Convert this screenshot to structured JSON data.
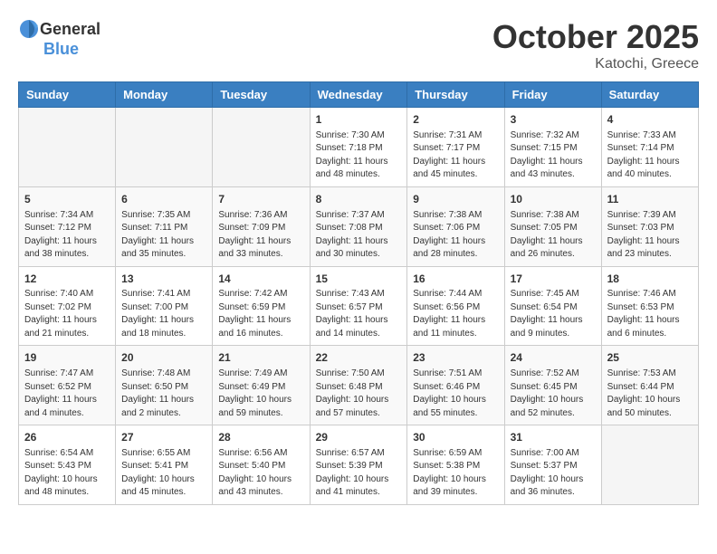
{
  "header": {
    "logo_general": "General",
    "logo_blue": "Blue",
    "title": "October 2025",
    "location": "Katochi, Greece"
  },
  "weekdays": [
    "Sunday",
    "Monday",
    "Tuesday",
    "Wednesday",
    "Thursday",
    "Friday",
    "Saturday"
  ],
  "weeks": [
    [
      {
        "day": "",
        "sunrise": "",
        "sunset": "",
        "daylight": ""
      },
      {
        "day": "",
        "sunrise": "",
        "sunset": "",
        "daylight": ""
      },
      {
        "day": "",
        "sunrise": "",
        "sunset": "",
        "daylight": ""
      },
      {
        "day": "1",
        "sunrise": "Sunrise: 7:30 AM",
        "sunset": "Sunset: 7:18 PM",
        "daylight": "Daylight: 11 hours and 48 minutes."
      },
      {
        "day": "2",
        "sunrise": "Sunrise: 7:31 AM",
        "sunset": "Sunset: 7:17 PM",
        "daylight": "Daylight: 11 hours and 45 minutes."
      },
      {
        "day": "3",
        "sunrise": "Sunrise: 7:32 AM",
        "sunset": "Sunset: 7:15 PM",
        "daylight": "Daylight: 11 hours and 43 minutes."
      },
      {
        "day": "4",
        "sunrise": "Sunrise: 7:33 AM",
        "sunset": "Sunset: 7:14 PM",
        "daylight": "Daylight: 11 hours and 40 minutes."
      }
    ],
    [
      {
        "day": "5",
        "sunrise": "Sunrise: 7:34 AM",
        "sunset": "Sunset: 7:12 PM",
        "daylight": "Daylight: 11 hours and 38 minutes."
      },
      {
        "day": "6",
        "sunrise": "Sunrise: 7:35 AM",
        "sunset": "Sunset: 7:11 PM",
        "daylight": "Daylight: 11 hours and 35 minutes."
      },
      {
        "day": "7",
        "sunrise": "Sunrise: 7:36 AM",
        "sunset": "Sunset: 7:09 PM",
        "daylight": "Daylight: 11 hours and 33 minutes."
      },
      {
        "day": "8",
        "sunrise": "Sunrise: 7:37 AM",
        "sunset": "Sunset: 7:08 PM",
        "daylight": "Daylight: 11 hours and 30 minutes."
      },
      {
        "day": "9",
        "sunrise": "Sunrise: 7:38 AM",
        "sunset": "Sunset: 7:06 PM",
        "daylight": "Daylight: 11 hours and 28 minutes."
      },
      {
        "day": "10",
        "sunrise": "Sunrise: 7:38 AM",
        "sunset": "Sunset: 7:05 PM",
        "daylight": "Daylight: 11 hours and 26 minutes."
      },
      {
        "day": "11",
        "sunrise": "Sunrise: 7:39 AM",
        "sunset": "Sunset: 7:03 PM",
        "daylight": "Daylight: 11 hours and 23 minutes."
      }
    ],
    [
      {
        "day": "12",
        "sunrise": "Sunrise: 7:40 AM",
        "sunset": "Sunset: 7:02 PM",
        "daylight": "Daylight: 11 hours and 21 minutes."
      },
      {
        "day": "13",
        "sunrise": "Sunrise: 7:41 AM",
        "sunset": "Sunset: 7:00 PM",
        "daylight": "Daylight: 11 hours and 18 minutes."
      },
      {
        "day": "14",
        "sunrise": "Sunrise: 7:42 AM",
        "sunset": "Sunset: 6:59 PM",
        "daylight": "Daylight: 11 hours and 16 minutes."
      },
      {
        "day": "15",
        "sunrise": "Sunrise: 7:43 AM",
        "sunset": "Sunset: 6:57 PM",
        "daylight": "Daylight: 11 hours and 14 minutes."
      },
      {
        "day": "16",
        "sunrise": "Sunrise: 7:44 AM",
        "sunset": "Sunset: 6:56 PM",
        "daylight": "Daylight: 11 hours and 11 minutes."
      },
      {
        "day": "17",
        "sunrise": "Sunrise: 7:45 AM",
        "sunset": "Sunset: 6:54 PM",
        "daylight": "Daylight: 11 hours and 9 minutes."
      },
      {
        "day": "18",
        "sunrise": "Sunrise: 7:46 AM",
        "sunset": "Sunset: 6:53 PM",
        "daylight": "Daylight: 11 hours and 6 minutes."
      }
    ],
    [
      {
        "day": "19",
        "sunrise": "Sunrise: 7:47 AM",
        "sunset": "Sunset: 6:52 PM",
        "daylight": "Daylight: 11 hours and 4 minutes."
      },
      {
        "day": "20",
        "sunrise": "Sunrise: 7:48 AM",
        "sunset": "Sunset: 6:50 PM",
        "daylight": "Daylight: 11 hours and 2 minutes."
      },
      {
        "day": "21",
        "sunrise": "Sunrise: 7:49 AM",
        "sunset": "Sunset: 6:49 PM",
        "daylight": "Daylight: 10 hours and 59 minutes."
      },
      {
        "day": "22",
        "sunrise": "Sunrise: 7:50 AM",
        "sunset": "Sunset: 6:48 PM",
        "daylight": "Daylight: 10 hours and 57 minutes."
      },
      {
        "day": "23",
        "sunrise": "Sunrise: 7:51 AM",
        "sunset": "Sunset: 6:46 PM",
        "daylight": "Daylight: 10 hours and 55 minutes."
      },
      {
        "day": "24",
        "sunrise": "Sunrise: 7:52 AM",
        "sunset": "Sunset: 6:45 PM",
        "daylight": "Daylight: 10 hours and 52 minutes."
      },
      {
        "day": "25",
        "sunrise": "Sunrise: 7:53 AM",
        "sunset": "Sunset: 6:44 PM",
        "daylight": "Daylight: 10 hours and 50 minutes."
      }
    ],
    [
      {
        "day": "26",
        "sunrise": "Sunrise: 6:54 AM",
        "sunset": "Sunset: 5:43 PM",
        "daylight": "Daylight: 10 hours and 48 minutes."
      },
      {
        "day": "27",
        "sunrise": "Sunrise: 6:55 AM",
        "sunset": "Sunset: 5:41 PM",
        "daylight": "Daylight: 10 hours and 45 minutes."
      },
      {
        "day": "28",
        "sunrise": "Sunrise: 6:56 AM",
        "sunset": "Sunset: 5:40 PM",
        "daylight": "Daylight: 10 hours and 43 minutes."
      },
      {
        "day": "29",
        "sunrise": "Sunrise: 6:57 AM",
        "sunset": "Sunset: 5:39 PM",
        "daylight": "Daylight: 10 hours and 41 minutes."
      },
      {
        "day": "30",
        "sunrise": "Sunrise: 6:59 AM",
        "sunset": "Sunset: 5:38 PM",
        "daylight": "Daylight: 10 hours and 39 minutes."
      },
      {
        "day": "31",
        "sunrise": "Sunrise: 7:00 AM",
        "sunset": "Sunset: 5:37 PM",
        "daylight": "Daylight: 10 hours and 36 minutes."
      },
      {
        "day": "",
        "sunrise": "",
        "sunset": "",
        "daylight": ""
      }
    ]
  ]
}
